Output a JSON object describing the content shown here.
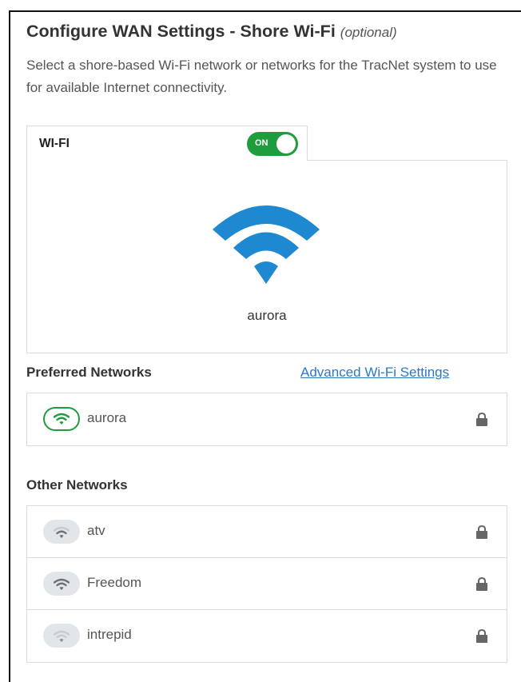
{
  "header": {
    "title": "Configure WAN Settings - Shore Wi-Fi",
    "optional": "(optional)",
    "description": "Select a shore-based Wi-Fi network or networks for the TracNet system to use for available Internet connectivity."
  },
  "wifi_tab": {
    "label": "WI-FI",
    "toggle_label": "ON",
    "toggle_state": "on",
    "current_network": "aurora"
  },
  "preferred": {
    "title": "Preferred Networks",
    "advanced_link": "Advanced Wi-Fi Settings",
    "networks": [
      {
        "ssid": "aurora",
        "signal": "full",
        "icon": "wifi-icon",
        "secured": true
      }
    ]
  },
  "other": {
    "title": "Other Networks",
    "networks": [
      {
        "ssid": "atv",
        "signal": "medium",
        "icon": "wifi-icon",
        "secured": true
      },
      {
        "ssid": "Freedom",
        "signal": "medium",
        "icon": "wifi-icon",
        "secured": true
      },
      {
        "ssid": "intrepid",
        "signal": "weak",
        "icon": "wifi-icon",
        "secured": true
      }
    ]
  },
  "colors": {
    "accent_green": "#1f9d3e",
    "wifi_blue": "#1e88d0",
    "link_blue": "#2b78c4",
    "icon_gray": "#8a8f94"
  }
}
